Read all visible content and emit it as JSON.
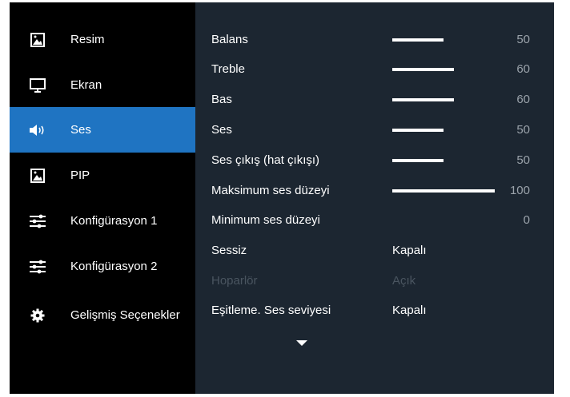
{
  "sidebar": {
    "items": [
      {
        "label": "Resim",
        "icon": "picture-icon",
        "active": false
      },
      {
        "label": "Ekran",
        "icon": "monitor-icon",
        "active": false
      },
      {
        "label": "Ses",
        "icon": "speaker-icon",
        "active": true
      },
      {
        "label": "PIP",
        "icon": "picture-icon",
        "active": false
      },
      {
        "label": "Konfigürasyon 1",
        "icon": "sliders-icon",
        "active": false
      },
      {
        "label": "Konfigürasyon 2",
        "icon": "sliders-icon",
        "active": false
      },
      {
        "label": "Gelişmiş Seçenekler",
        "icon": "gear-icon",
        "active": false
      }
    ]
  },
  "settings": [
    {
      "label": "Balans",
      "type": "slider",
      "value": 50,
      "max": 100
    },
    {
      "label": "Treble",
      "type": "slider",
      "value": 60,
      "max": 100
    },
    {
      "label": "Bas",
      "type": "slider",
      "value": 60,
      "max": 100
    },
    {
      "label": "Ses",
      "type": "slider",
      "value": 50,
      "max": 100
    },
    {
      "label": "Ses çıkış (hat çıkışı)",
      "type": "slider",
      "value": 50,
      "max": 100
    },
    {
      "label": "Maksimum ses düzeyi",
      "type": "slider",
      "value": 100,
      "max": 100
    },
    {
      "label": "Minimum ses düzeyi",
      "type": "slider",
      "value": 0,
      "max": 100
    },
    {
      "label": "Sessiz",
      "type": "option",
      "value": "Kapalı",
      "enabled": true
    },
    {
      "label": "Hoparlör",
      "type": "option",
      "value": "Açık",
      "enabled": false
    },
    {
      "label": "Eşitleme. Ses seviyesi",
      "type": "option",
      "value": "Kapalı",
      "enabled": true
    }
  ],
  "colors": {
    "active": "#1f74c2",
    "panel": "#1c2631",
    "sidebar": "#000000",
    "number": "#9aa2aa",
    "disabled": "#4a5560"
  },
  "more_icon": "chevron-down-icon"
}
